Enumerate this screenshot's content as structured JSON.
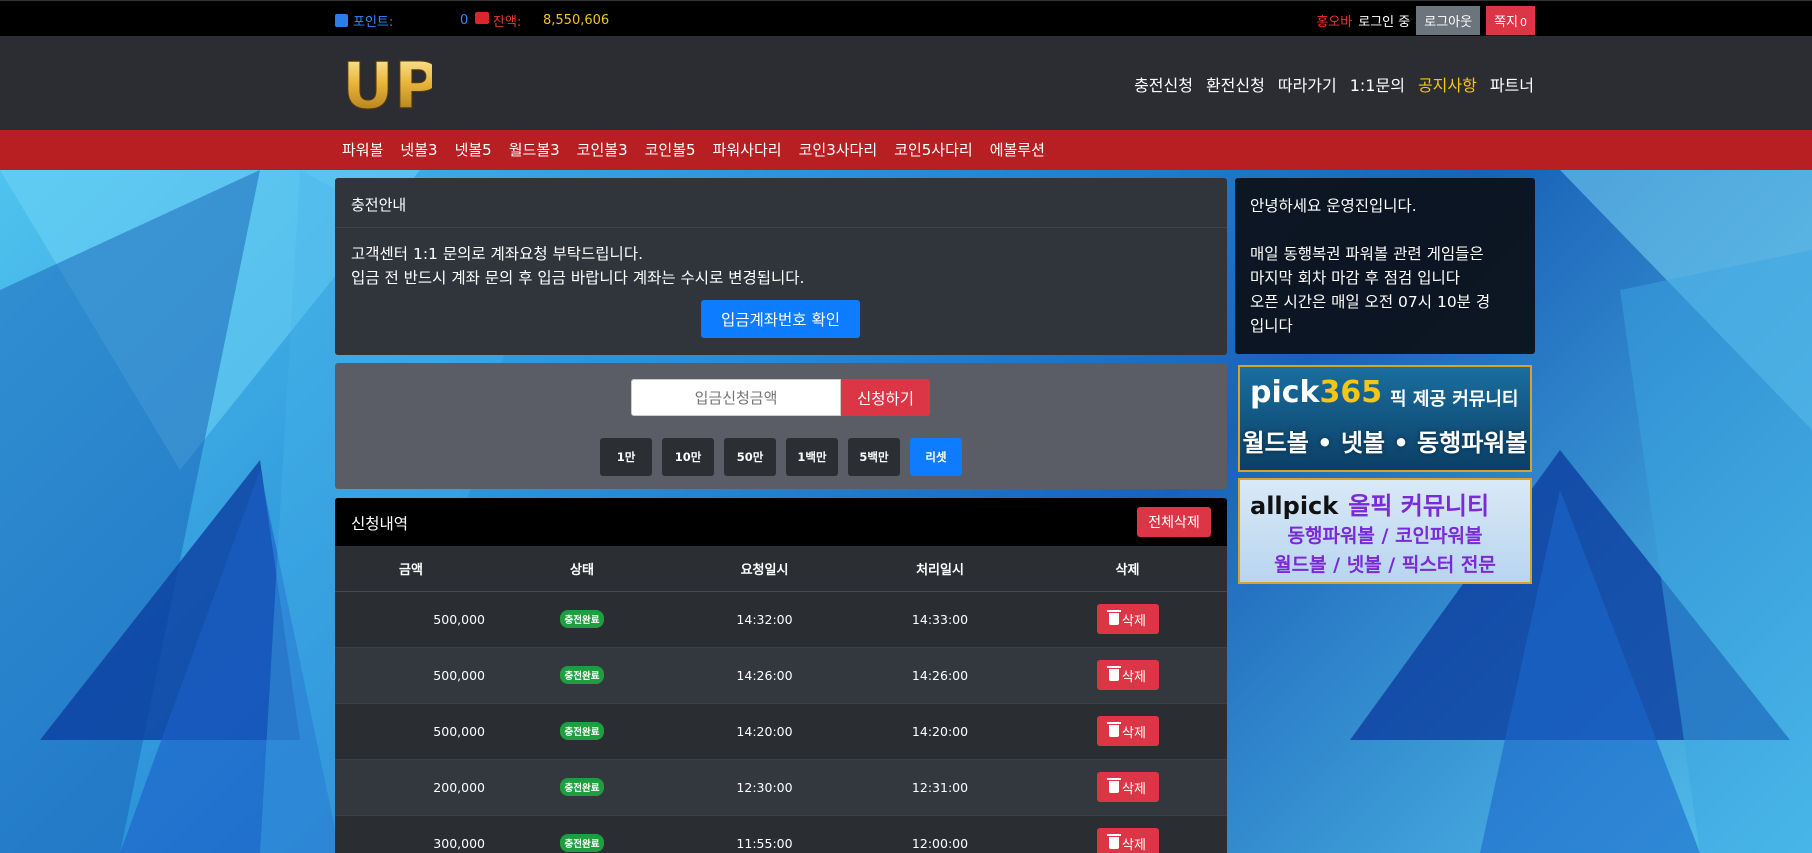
{
  "topbar": {
    "point_label": "포인트:",
    "point_value": "0",
    "balance_label": "잔액:",
    "balance_value": "8,550,606",
    "username": "홍오바",
    "login_status": "로그인 중",
    "logout_label": "로그아웃",
    "memo_label": "쪽지",
    "memo_count": "0"
  },
  "header": {
    "logo_text": "UP",
    "nav": [
      "충전신청",
      "환전신청",
      "따라가기",
      "1:1문의",
      "공지사항",
      "파트너"
    ]
  },
  "game_nav": [
    "파워볼",
    "넷볼3",
    "넷볼5",
    "월드볼3",
    "코인볼3",
    "코인볼5",
    "파워사다리",
    "코인3사다리",
    "코인5사다리",
    "에볼루션"
  ],
  "guide": {
    "title": "충전안내",
    "line1": "고객센터 1:1 문의로 계좌요청 부탁드립니다.",
    "line2": "입금 전 반드시 계좌 문의 후 입금 바랍니다 계좌는 수시로 변경됩니다.",
    "account_button": "입금계좌번호 확인"
  },
  "request": {
    "amount_placeholder": "입금신청금액",
    "apply_button": "신청하기",
    "chips": [
      "1만",
      "10만",
      "50만",
      "1백만",
      "5백만",
      "리셋"
    ]
  },
  "history": {
    "title": "신청내역",
    "delete_all": "전체삭제",
    "columns": [
      "금액",
      "상태",
      "요청일시",
      "처리일시",
      "삭제"
    ],
    "rows": [
      {
        "amount": "500,000",
        "status": "충전완료",
        "requested": "14:32:00",
        "processed": "14:33:00",
        "delete": "삭제"
      },
      {
        "amount": "500,000",
        "status": "충전완료",
        "requested": "14:26:00",
        "processed": "14:26:00",
        "delete": "삭제"
      },
      {
        "amount": "500,000",
        "status": "충전완료",
        "requested": "14:20:00",
        "processed": "14:20:00",
        "delete": "삭제"
      },
      {
        "amount": "200,000",
        "status": "충전완료",
        "requested": "12:30:00",
        "processed": "12:31:00",
        "delete": "삭제"
      },
      {
        "amount": "300,000",
        "status": "충전완료",
        "requested": "11:55:00",
        "processed": "12:00:00",
        "delete": "삭제"
      }
    ]
  },
  "notice": {
    "greeting": "안녕하세요 운영진입니다.",
    "line1": "매일 동행복권 파워볼 관련 게임들은",
    "line2": "마지막 회차 마감 후 점검 입니다",
    "line3": "오픈 시간은 매일 오전 07시 10분 경",
    "line4": "입니다"
  },
  "banners": {
    "b1_brand_prefix": "pick",
    "b1_brand_number": "365",
    "b1_tag": "픽 제공 커뮤니티",
    "b1_line": "월드볼 • 넷볼 • 동행파워볼",
    "b2_brand": "allpick",
    "b2_tag": "올픽 커뮤니티",
    "b2_line1": "동행파워볼 / 코인파워볼",
    "b2_line2": "월드볼 / 넷볼 / 픽스터 전문"
  },
  "colors": {
    "accent_blue": "#0d7cff",
    "danger_red": "#dc3545",
    "nav_red": "#b81f22",
    "highlight_yellow": "#f5c518",
    "success_green": "#1e9e3e"
  }
}
